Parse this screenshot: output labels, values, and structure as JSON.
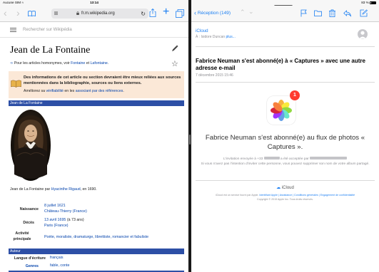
{
  "status_bar": {
    "carrier": "Aucune SIM",
    "time": "13:14",
    "battery": "83 %"
  },
  "safari": {
    "url": "fr.m.wikipedia.org"
  },
  "wiki": {
    "search_placeholder": "Rechercher sur Wikipédia",
    "title": "Jean de La Fontaine",
    "hatnote_prefix": "Pour les articles homonymes, voir",
    "hatnote_link1": "Fontaine",
    "hatnote_mid": "et",
    "hatnote_link2": "Lafontaine",
    "ambox_text": "Des informations de cet article ou section devraient être mieux reliées aux sources mentionnées dans la bibliographie, sources ou liens externes.",
    "ambox_sub_prefix": "Améliorez sa",
    "ambox_sub_link1": "vérifiabilité",
    "ambox_sub_mid": "en les",
    "ambox_sub_link2": "associant par des références",
    "infobox_header": "Jean de La Fontaine",
    "caption_prefix": "Jean de La Fontaine par",
    "caption_link": "Hyacinthe Rigaud",
    "caption_suffix": ", en 1690.",
    "rows": {
      "naissance_label": "Naissance",
      "naissance_date": "8 juillet 1621",
      "naissance_place": "Château-Thierry (France)",
      "deces_label": "Décès",
      "deces_date": "13 avril 1695",
      "deces_age": " (à 73 ans)",
      "deces_place": "Paris (France)",
      "activite_label": "Activité principale",
      "activite_value": "Poète, moraliste, dramaturge, librettiste, romancier et fabuliste"
    },
    "auteur_header": "Auteur",
    "langue_label": "Langue d'écriture",
    "langue_value": "français",
    "genres_label": "Genres",
    "genres_value": "fable, conte"
  },
  "mail": {
    "back_label": "Réception (149)",
    "from": "iCloud",
    "to_prefix": "À : Isidore Duncan",
    "to_more": "plus...",
    "subject": "Fabrice Neuman s'est abonné(e) à « Captures » avec une autre adresse e-mail",
    "date": "7 décembre 2015 15:46",
    "badge_count": "1",
    "big_message": "Fabrice Neuman s'est abonné(e) au flux de photos « Captures ».",
    "invite_line1_a": "L'invitation envoyée à +33",
    "invite_line1_b": "a été acceptée par",
    "invite_line2": "Si vous n'avez pas l'intention d'inviter cette personne, vous pouvez supprimer son nom de votre album partagé.",
    "icloud_label": "iCloud",
    "footer_prefix": "iCloud est un service fourni par Apple.",
    "footer_links": "Identifiant Apple | Assistance | Conditions générales | Engagement de confidentialité",
    "footer_copyright": "Copyright © 2015 Apple Inc. Tous droits réservés."
  },
  "colors": {
    "ios_blue": "#1a7ef2",
    "wiki_link": "#0645ad",
    "infobox_blue": "#2d4fa6",
    "ambox_bg": "#fbe8d7",
    "badge_red": "#ff3b30"
  }
}
